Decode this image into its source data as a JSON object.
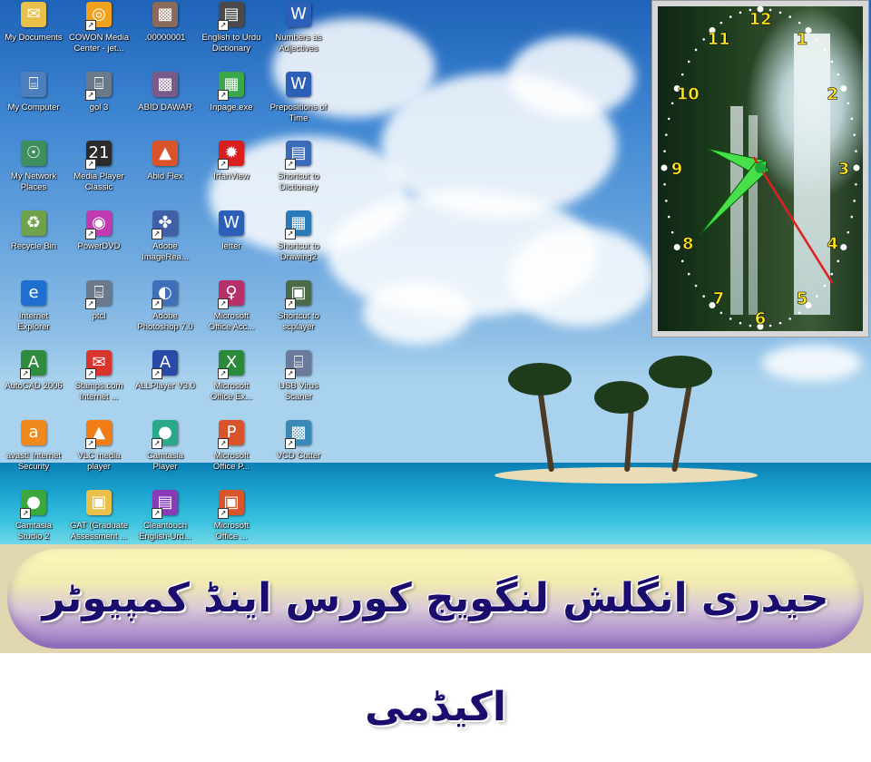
{
  "desktop": {
    "icons": [
      {
        "label": "My Documents",
        "icon": "folder-docs-icon",
        "color": "#e8c04a",
        "glyph": "✉",
        "shortcut": false
      },
      {
        "label": "My Computer",
        "icon": "computer-icon",
        "color": "#4d7fbf",
        "glyph": "⌸",
        "shortcut": false
      },
      {
        "label": "My Network\nPlaces",
        "icon": "network-icon",
        "color": "#3f8f5e",
        "glyph": "☉",
        "shortcut": false
      },
      {
        "label": "Recycle Bin",
        "icon": "recycle-bin-icon",
        "color": "#6fa24a",
        "glyph": "♻",
        "shortcut": false
      },
      {
        "label": "Internet\nExplorer",
        "icon": "internet-explorer-icon",
        "color": "#1f6fd1",
        "glyph": "e",
        "shortcut": false
      },
      {
        "label": "AutoCAD 2006",
        "icon": "autocad-icon",
        "color": "#2f8c3e",
        "glyph": "A",
        "shortcut": true
      },
      {
        "label": "avast! Internet\nSecurity",
        "icon": "avast-icon",
        "color": "#f08a1e",
        "glyph": "a",
        "shortcut": false
      },
      {
        "label": "Camtasia\nStudio 2",
        "icon": "camtasia-studio-icon",
        "color": "#3aa83a",
        "glyph": "●",
        "shortcut": true
      },
      {
        "label": "COWON Media\nCenter - jet...",
        "icon": "cowon-icon",
        "color": "#f0a21e",
        "glyph": "◎",
        "shortcut": true
      },
      {
        "label": "gol 3",
        "icon": "gol-icon",
        "color": "#6a7a8a",
        "glyph": "⌸",
        "shortcut": true
      },
      {
        "label": "Media Player\nClassic",
        "icon": "media-player-classic-icon",
        "color": "#2b2b2b",
        "glyph": "21",
        "shortcut": true
      },
      {
        "label": "PowerDVD",
        "icon": "powerdvd-icon",
        "color": "#c03ab0",
        "glyph": "◉",
        "shortcut": true
      },
      {
        "label": "ptcl",
        "icon": "ptcl-icon",
        "color": "#6a7a8a",
        "glyph": "⌸",
        "shortcut": true
      },
      {
        "label": "Stamps.com\nInternet ...",
        "icon": "stamps-icon",
        "color": "#d9342b",
        "glyph": "✉",
        "shortcut": true
      },
      {
        "label": "VLC media\nplayer",
        "icon": "vlc-icon",
        "color": "#f07d16",
        "glyph": "▲",
        "shortcut": true
      },
      {
        "label": "GAT (Graduate\nAssessment ...",
        "icon": "folder-icon",
        "color": "#e8c04a",
        "glyph": "▣",
        "shortcut": false
      },
      {
        "label": ".00000001",
        "icon": "image-file-icon",
        "color": "#8a6a5a",
        "glyph": "▩",
        "shortcut": false
      },
      {
        "label": "ABID DAWAR",
        "icon": "image-file-icon",
        "color": "#7a5a8a",
        "glyph": "▩",
        "shortcut": false
      },
      {
        "label": "Abid Flex",
        "icon": "flex-file-icon",
        "color": "#d9542b",
        "glyph": "▲",
        "shortcut": false
      },
      {
        "label": "Adobe\nImageRea...",
        "icon": "adobe-imageready-icon",
        "color": "#3f5fa8",
        "glyph": "✤",
        "shortcut": true
      },
      {
        "label": "Adobe\nPhotoshop 7.0",
        "icon": "adobe-photoshop-icon",
        "color": "#3f6fb8",
        "glyph": "◐",
        "shortcut": true
      },
      {
        "label": "ALLPlayer V3.0",
        "icon": "allplayer-icon",
        "color": "#2a4aa8",
        "glyph": "A",
        "shortcut": true
      },
      {
        "label": "Camtasia\nPlayer",
        "icon": "camtasia-player-icon",
        "color": "#2aa88a",
        "glyph": "●",
        "shortcut": true
      },
      {
        "label": "Cleantouch\nEnglish-Urd...",
        "icon": "cleantouch-icon",
        "color": "#8a3ab8",
        "glyph": "▤",
        "shortcut": true
      },
      {
        "label": "English to Urdu\nDictionary",
        "icon": "dictionary-icon",
        "color": "#4a4a4a",
        "glyph": "▤",
        "shortcut": true
      },
      {
        "label": "Inpage.exe",
        "icon": "inpage-icon",
        "color": "#3aa84a",
        "glyph": "▦",
        "shortcut": true
      },
      {
        "label": "IrfanView",
        "icon": "irfanview-icon",
        "color": "#d91e1e",
        "glyph": "✹",
        "shortcut": true
      },
      {
        "label": "letter",
        "icon": "word-doc-icon",
        "color": "#2b5fb8",
        "glyph": "W",
        "shortcut": false
      },
      {
        "label": "Microsoft\nOffice Acc...",
        "icon": "ms-access-icon",
        "color": "#b8306a",
        "glyph": "♀",
        "shortcut": true
      },
      {
        "label": "Microsoft\nOffice Ex...",
        "icon": "ms-excel-icon",
        "color": "#2a8a3a",
        "glyph": "X",
        "shortcut": true
      },
      {
        "label": "Microsoft\nOffice P...",
        "icon": "ms-powerpoint-icon",
        "color": "#d9542b",
        "glyph": "P",
        "shortcut": true
      },
      {
        "label": "Microsoft\nOffice ...",
        "icon": "ms-office-icon",
        "color": "#d9542b",
        "glyph": "▣",
        "shortcut": true
      },
      {
        "label": "Numbers as\nAdjectives",
        "icon": "word-doc-icon",
        "color": "#2b5fb8",
        "glyph": "W",
        "shortcut": false
      },
      {
        "label": "Prepositions of\nTime",
        "icon": "word-doc-icon",
        "color": "#2b5fb8",
        "glyph": "W",
        "shortcut": false
      },
      {
        "label": "Shortcut to\nDictionary",
        "icon": "dictionary-shortcut-icon",
        "color": "#3a6ab8",
        "glyph": "▤",
        "shortcut": true
      },
      {
        "label": "Shortcut to\nDrawing2",
        "icon": "drawing-icon",
        "color": "#2a7ab8",
        "glyph": "▦",
        "shortcut": true
      },
      {
        "label": "Shortcut to\nscplayer",
        "icon": "scplayer-icon",
        "color": "#4a6a4a",
        "glyph": "▣",
        "shortcut": true
      },
      {
        "label": "USB Virus\nScaner",
        "icon": "usb-scanner-icon",
        "color": "#6a7a9a",
        "glyph": "⌸",
        "shortcut": true
      },
      {
        "label": "VCD Cutter",
        "icon": "vcd-cutter-icon",
        "color": "#3a8ab8",
        "glyph": "▩",
        "shortcut": true
      }
    ]
  },
  "clock": {
    "numerals": [
      "12",
      "1",
      "2",
      "3",
      "4",
      "5",
      "6",
      "7",
      "8",
      "9",
      "10",
      "11"
    ],
    "colors": {
      "numerals": "#ffe51a",
      "hands": "#48e04a",
      "second_hand": "#e02020"
    }
  },
  "banner": {
    "text": "حیدری انگلش لنگویج کورس اینڈ کمپیوٹر اکیڈمی"
  }
}
